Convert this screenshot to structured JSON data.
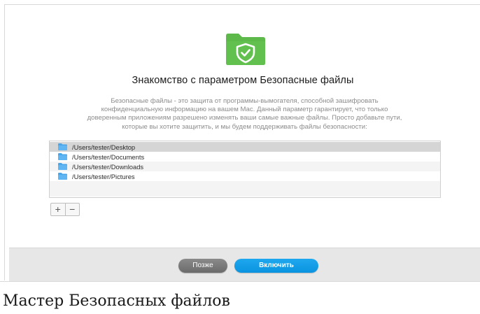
{
  "dialog": {
    "icon": "shield-folder-icon",
    "title": "Знакомство с параметром Безопасные файлы",
    "description_lines": [
      "Безопасные файлы - это защита от программы-вымогателя, способной зашифровать",
      "конфиденциальную информацию на вашем Mac. Данный параметр гарантирует, что только",
      "доверенным приложениям разрешено изменять ваши самые важные файлы. Просто добавьте пути,",
      "которые вы хотите защитить, и мы будем поддерживать файлы безопасности:"
    ],
    "paths": [
      "/Users/tester/Desktop",
      "/Users/tester/Documents",
      "/Users/tester/Downloads",
      "/Users/tester/Pictures"
    ],
    "add_label": "+",
    "remove_label": "−",
    "later_button": "Позже",
    "enable_button": "Включить"
  },
  "colors": {
    "accent_green": "#58b847",
    "button_blue": "#0f9be4",
    "button_gray": "#777777",
    "footer_bg": "#e7e7e7"
  },
  "caption": "Мастер Безопасных файлов"
}
